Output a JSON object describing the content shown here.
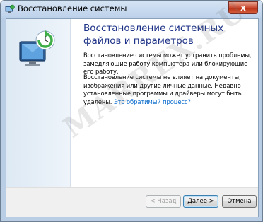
{
  "window": {
    "title": "Восстановление системы",
    "close_symbol": "x",
    "app_icon": "system-restore-icon"
  },
  "sidebar": {
    "icon": "system-restore-wizard-icon"
  },
  "main": {
    "heading": "Восстановление системных файлов и параметров",
    "paragraph1": "Восстановление системы может устранить проблемы, замедляющие работу компьютера или блокирующие его работу.",
    "paragraph2_text": "Восстановление системы не влияет на документы, изображения или другие личные данные. Недавно установленные программы и драйверы могут быть удалены.",
    "paragraph2_link": "Это обратимый процесс?"
  },
  "buttons": {
    "back": "< Назад",
    "next": "Далее >",
    "cancel": "Отмена"
  },
  "watermark": "MARREX.RU",
  "colors": {
    "heading": "#1e3287",
    "link": "#0066cc",
    "close_button": "#c8462e",
    "frame": "#b9cde4"
  }
}
